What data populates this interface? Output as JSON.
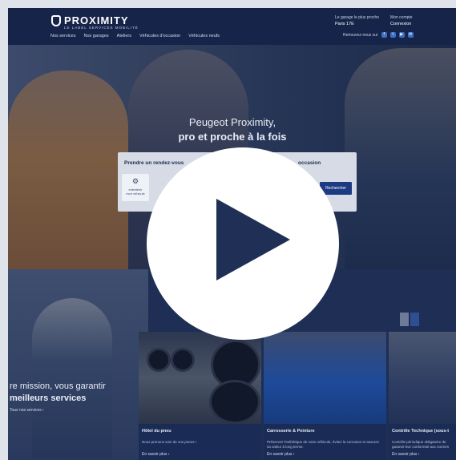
{
  "brand": {
    "name": "PROXIMITY",
    "tagline": "LE LABEL SERVICES MOBILITÉ"
  },
  "nav": [
    "Nos services",
    "Nos garages",
    "Ateliers",
    "Véhicules d'occasion",
    "Véhicules neufs"
  ],
  "top_right": {
    "garage_label": "Le garage le plus proche",
    "garage_value": "Paris 17E",
    "account_label": "Mon compte",
    "account_value": "Connexion"
  },
  "social": {
    "label": "Retrouvez-nous sur",
    "icons": [
      "facebook-icon",
      "twitter-icon",
      "youtube-icon",
      "mail-icon"
    ]
  },
  "hero": {
    "line1": "Peugeot Proximity,",
    "line2": "pro et proche à la fois"
  },
  "rdv": {
    "title": "Prendre un rendez-vous",
    "right_title": "occasion",
    "card_label": "entretenir",
    "card_label2": "mon véhicule",
    "button": "Rechercher"
  },
  "mission": {
    "line1": "re mission, vous garantir",
    "line2": "meilleurs services",
    "link": "Tous nos services  ›"
  },
  "cards": [
    {
      "title": "Hôtel du pneu",
      "text": "Nous prenons soin de vos pneus !",
      "link": "En savoir plus  ›"
    },
    {
      "title": "Carrosserie & Peinture",
      "text": "Préservez l'esthétique de votre véhicule, évitez la corrosion et assurez sa valeur à long terme.",
      "link": "En savoir plus  ›"
    },
    {
      "title": "Contrôle Technique (sous-t",
      "text": "Contrôle périodique obligatoire de garantir leur conformité aux normes",
      "link": "En savoir plus  ›"
    }
  ],
  "colors": {
    "overlay": "#1c2c52",
    "accent": "#1d3b83",
    "play": "#ffffff"
  }
}
